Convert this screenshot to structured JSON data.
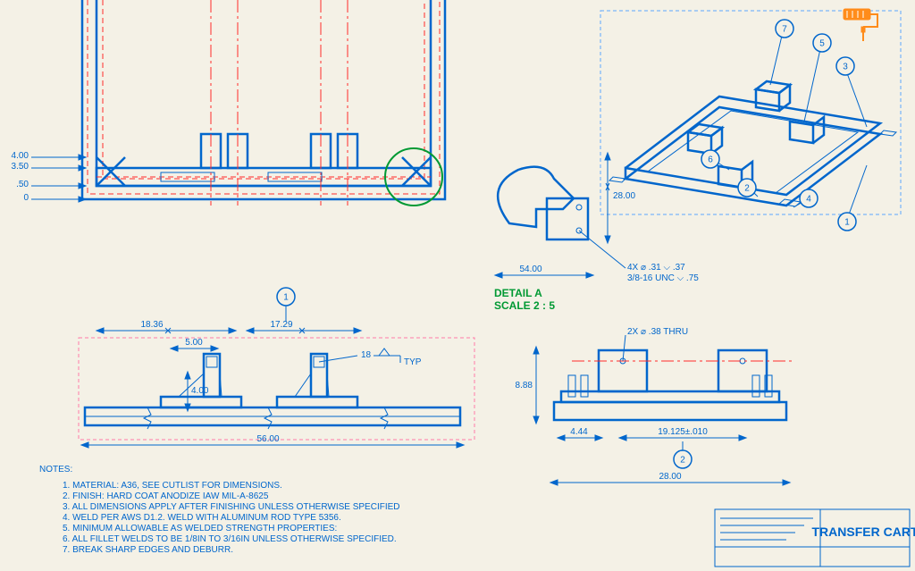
{
  "title_block": {
    "title": "TRANSFER CART"
  },
  "detail": {
    "label": "DETAIL A",
    "scale": "SCALE 2 : 5"
  },
  "top_dims": [
    "4.00",
    "3.50",
    ".50",
    "0"
  ],
  "sec_dims": {
    "span_left": "18.36",
    "span_right": "17.29",
    "small": "5.00",
    "height": "4.00",
    "overall": "56.00",
    "ldr_angle": "18",
    "typ": "TYP"
  },
  "right_dims": {
    "h": "8.88",
    "off": "4.44",
    "bolt": "19.125±.010",
    "w": "28.00",
    "holes": "2X ⌀ .38 THRU"
  },
  "detail_dims": {
    "v": "28.00",
    "h": "54.00",
    "holes1": "4X ⌀ .31 ⌵ .37",
    "holes2": "3/8-16 UNC ⌵ .75"
  },
  "balloons": [
    "1",
    "2",
    "3",
    "4",
    "5",
    "6",
    "7"
  ],
  "notes_header": "NOTES:",
  "notes": [
    "1.    MATERIAL:   A36, SEE CUTLIST FOR DIMENSIONS.",
    "2.    FINISH:   HARD COAT ANODIZE IAW MIL-A-8625",
    "3.    ALL DIMENSIONS APPLY AFTER FINISHING UNLESS OTHERWISE SPECIFIED",
    "4.    WELD PER AWS D1.2.  WELD WITH ALUMINUM ROD TYPE 5356.",
    "5.    MINIMUM ALLOWABLE AS WELDED STRENGTH PROPERTIES:",
    "6.    ALL FILLET WELDS TO BE 1/8IN TO 3/16IN UNLESS OTHERWISE SPECIFIED.",
    "7.    BREAK SHARP EDGES AND DEBURR."
  ]
}
